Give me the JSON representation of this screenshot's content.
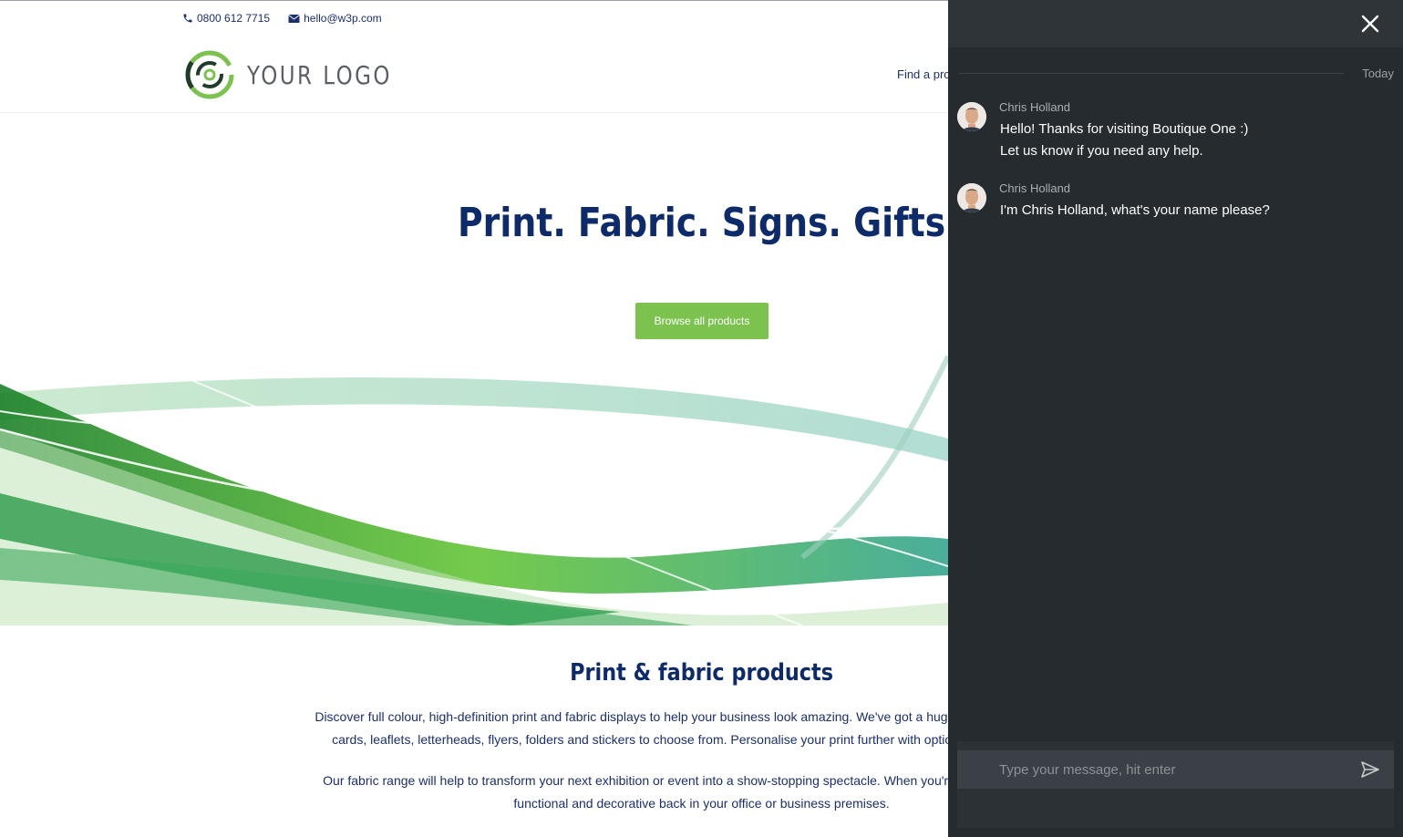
{
  "site": {
    "phone": "0800 612 7715",
    "email": "hello@w3p.com",
    "logo_text": "YOUR LOGO",
    "nav_partial": "Find a prod",
    "hero_title": "Print. Fabric. Signs. Gifts",
    "browse_button": "Browse all products",
    "products_title": "Print & fabric products",
    "paragraph_1_line_1": "Discover full colour, high-definition print and fabric displays to help your business look amazing. We've got a huge range of litho printed st",
    "paragraph_1_line_2": "cards, leaflets, letterheads, flyers, folders and stickers to choose from. Personalise your print further with optional finishing options t",
    "paragraph_2_line_1": "Our fabric range will help to transform your next exhibition or event into a show-stopping spectacle. When you're not busy hosting an e",
    "paragraph_2_line_2": "functional and decorative back in your office or business premises.",
    "colors": {
      "navy": "#0d2a6b",
      "green": "#7cc24f"
    }
  },
  "chat": {
    "date_label": "Today",
    "messages": [
      {
        "author": "Chris Holland",
        "lines": [
          "Hello! Thanks for visiting Boutique One :)",
          "Let us know if you need any help."
        ]
      },
      {
        "author": "Chris Holland",
        "lines": [
          "I'm Chris Holland, what's your name please?"
        ]
      }
    ],
    "input_placeholder": "Type your message, hit enter",
    "icons": {
      "close": "close-icon",
      "send": "send-icon"
    },
    "colors": {
      "panel": "#262b2f",
      "header": "#2e3438",
      "input": "#3a4045"
    }
  }
}
